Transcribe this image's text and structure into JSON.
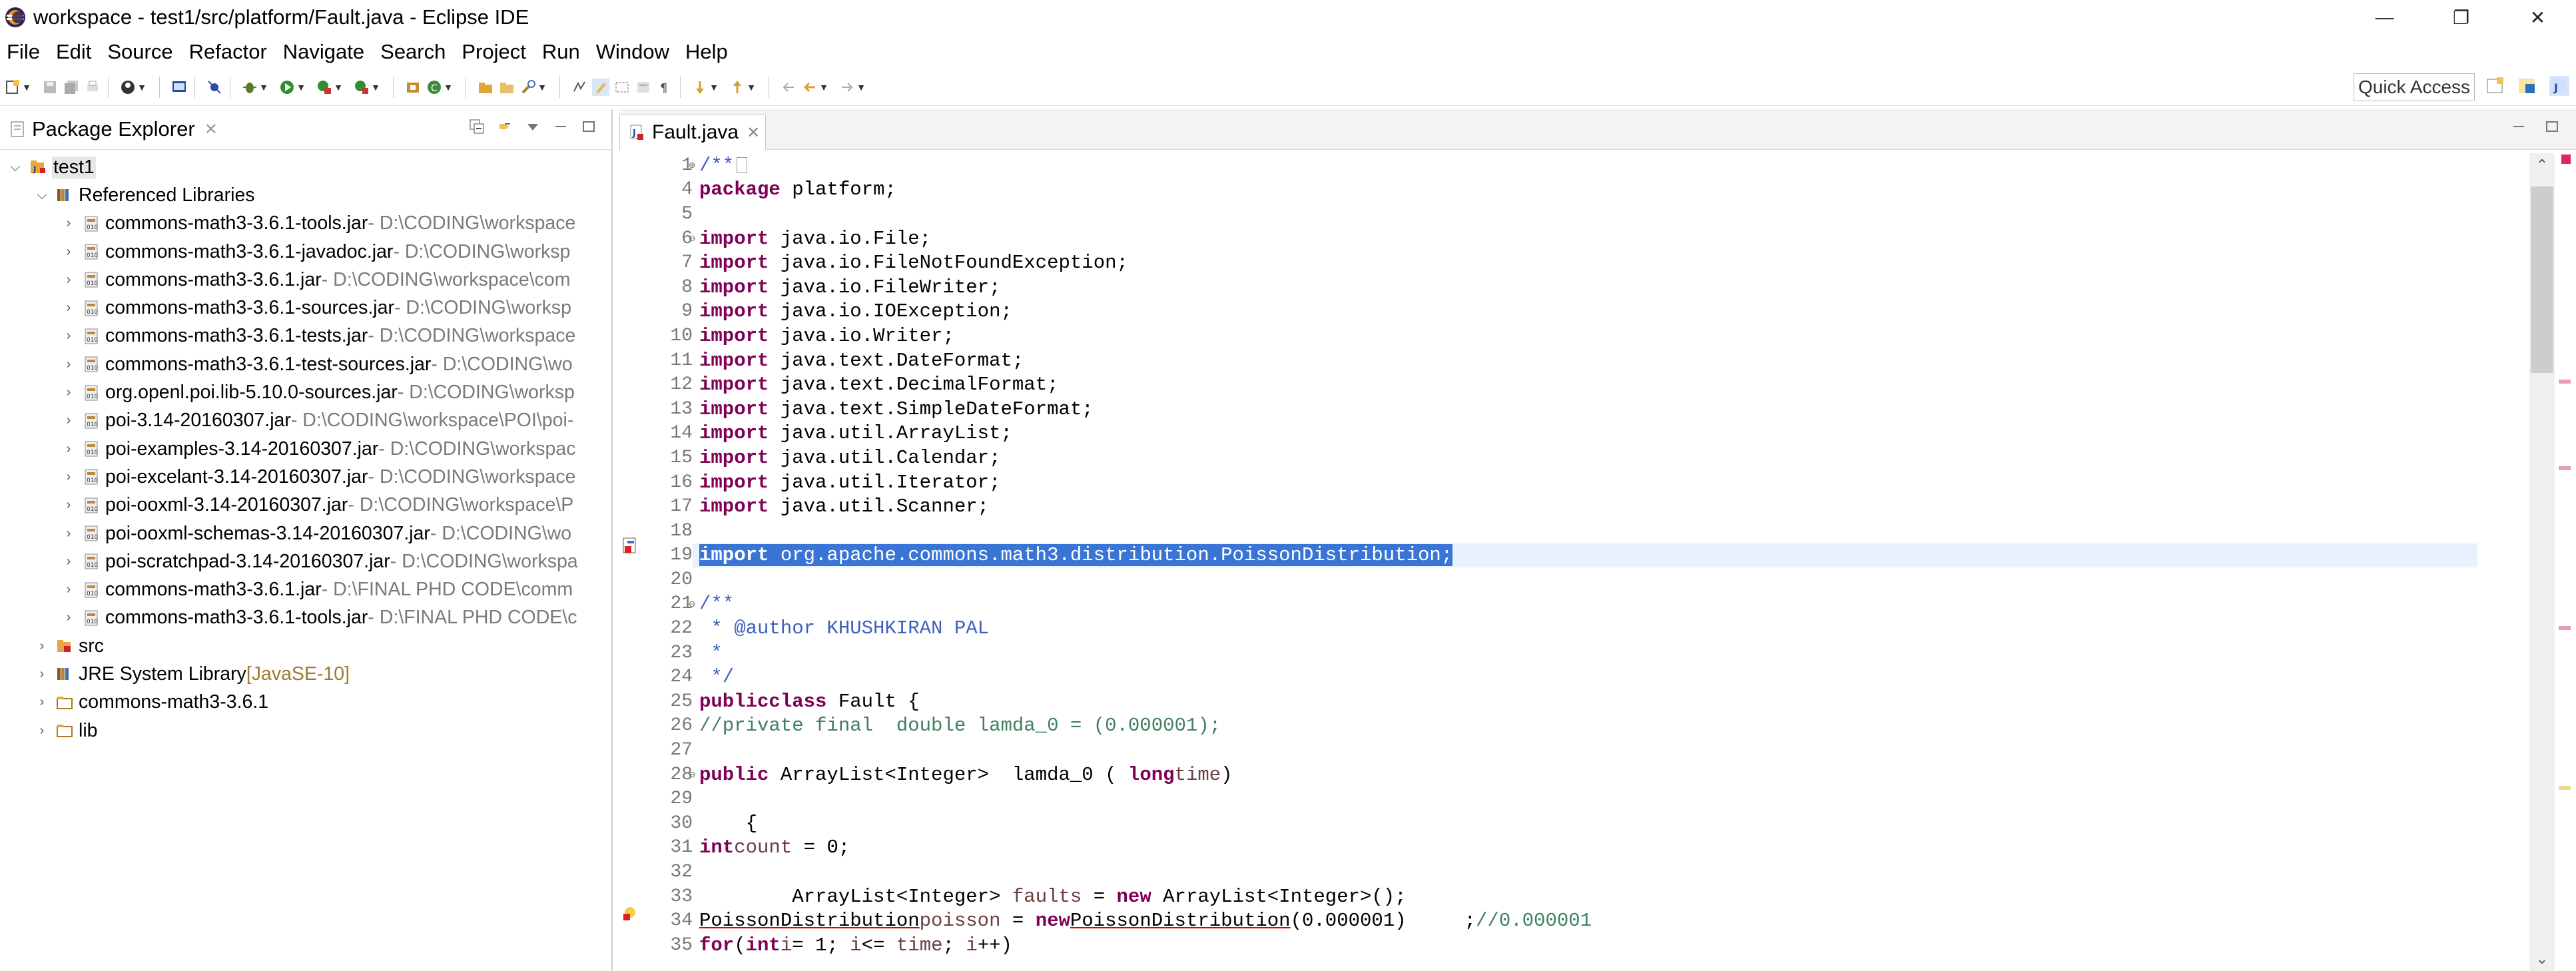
{
  "window": {
    "title": "workspace - test1/src/platform/Fault.java - Eclipse IDE",
    "controls": [
      "—",
      "❐",
      "✕"
    ]
  },
  "menu": [
    "File",
    "Edit",
    "Source",
    "Refactor",
    "Navigate",
    "Search",
    "Project",
    "Run",
    "Window",
    "Help"
  ],
  "toolbar": {
    "quick_access": "Quick Access"
  },
  "package_explorer": {
    "title": "Package Explorer",
    "close": "✕",
    "project": "test1",
    "referenced_libraries": "Referenced Libraries",
    "jars": [
      {
        "name": "commons-math3-3.6.1-tools.jar",
        "path": " - D:\\CODING\\workspace"
      },
      {
        "name": "commons-math3-3.6.1-javadoc.jar",
        "path": " - D:\\CODING\\worksp"
      },
      {
        "name": "commons-math3-3.6.1.jar",
        "path": " - D:\\CODING\\workspace\\com"
      },
      {
        "name": "commons-math3-3.6.1-sources.jar",
        "path": " - D:\\CODING\\worksp"
      },
      {
        "name": "commons-math3-3.6.1-tests.jar",
        "path": " - D:\\CODING\\workspace"
      },
      {
        "name": "commons-math3-3.6.1-test-sources.jar",
        "path": " - D:\\CODING\\wo"
      },
      {
        "name": "org.openl.poi.lib-5.10.0-sources.jar",
        "path": " - D:\\CODING\\worksp"
      },
      {
        "name": "poi-3.14-20160307.jar",
        "path": " - D:\\CODING\\workspace\\POI\\poi-"
      },
      {
        "name": "poi-examples-3.14-20160307.jar",
        "path": " - D:\\CODING\\workspac"
      },
      {
        "name": "poi-excelant-3.14-20160307.jar",
        "path": " - D:\\CODING\\workspace"
      },
      {
        "name": "poi-ooxml-3.14-20160307.jar",
        "path": " - D:\\CODING\\workspace\\P"
      },
      {
        "name": "poi-ooxml-schemas-3.14-20160307.jar",
        "path": " - D:\\CODING\\wo"
      },
      {
        "name": "poi-scratchpad-3.14-20160307.jar",
        "path": " - D:\\CODING\\workspa"
      },
      {
        "name": "commons-math3-3.6.1.jar",
        "path": " - D:\\FINAL PHD CODE\\comm"
      },
      {
        "name": "commons-math3-3.6.1-tools.jar",
        "path": " - D:\\FINAL PHD CODE\\c"
      }
    ],
    "src": "src",
    "jre": {
      "name": "JRE System Library",
      "tag": " [JavaSE-10]"
    },
    "folders": [
      "commons-math3-3.6.1",
      "lib"
    ]
  },
  "editor": {
    "tab": "Fault.java",
    "close": "✕",
    "line_numbers": [
      "1",
      "4",
      "5",
      "6",
      "7",
      "8",
      "9",
      "10",
      "11",
      "12",
      "13",
      "14",
      "15",
      "16",
      "17",
      "18",
      "19",
      "20",
      "21",
      "22",
      "23",
      "24",
      "25",
      "26",
      "27",
      "28",
      "29",
      "30",
      "31",
      "32",
      "33",
      "34",
      "35"
    ],
    "colors": {
      "keyword": "#7f0055",
      "comment": "#3f7f5f",
      "javadoc": "#3f5fbf",
      "selection": "#3875d7"
    }
  }
}
